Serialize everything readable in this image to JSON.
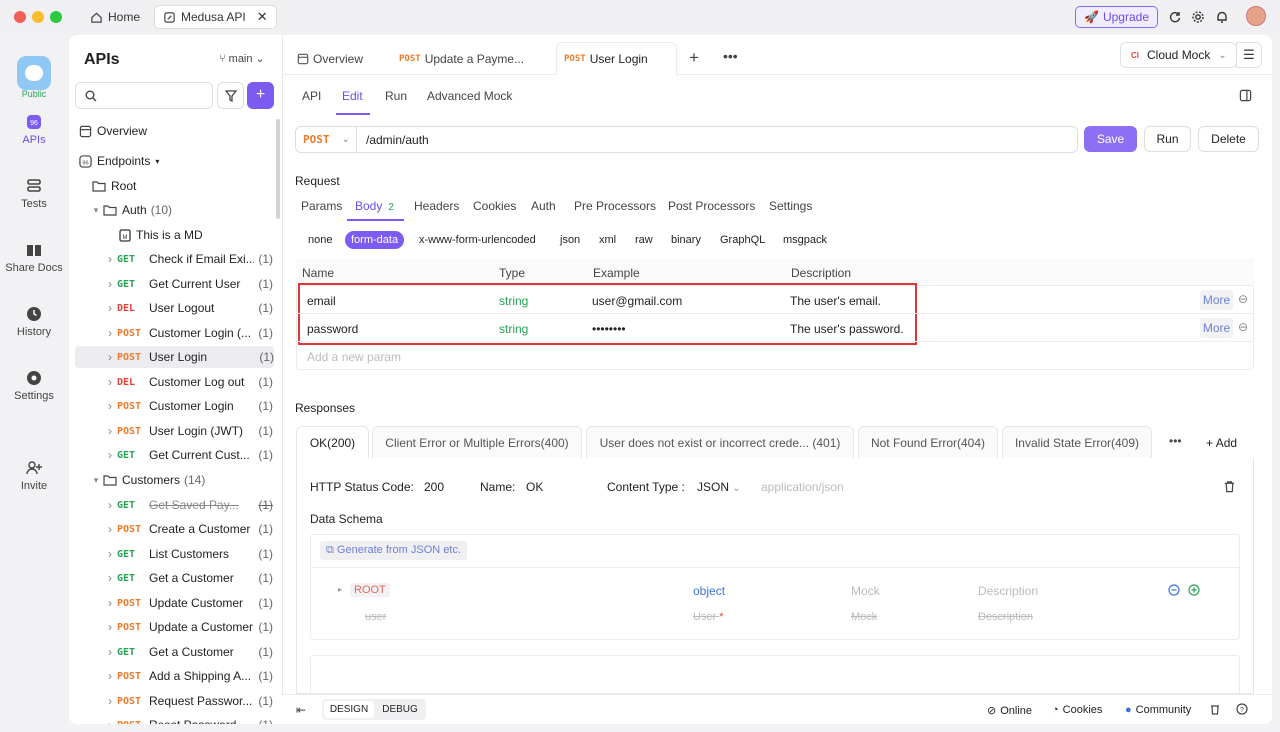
{
  "window": {
    "tabs": [
      {
        "label": "Home"
      },
      {
        "label": "Medusa API"
      }
    ],
    "upgrade": "Upgrade"
  },
  "rail": {
    "public": "Public",
    "items": [
      {
        "label": "APIs"
      },
      {
        "label": "Tests"
      },
      {
        "label": "Share Docs"
      },
      {
        "label": "History"
      },
      {
        "label": "Settings"
      },
      {
        "label": "Invite"
      }
    ]
  },
  "sidebar": {
    "title": "APIs",
    "branch": "main",
    "search_placeholder": "",
    "overview": "Overview",
    "endpoints": "Endpoints",
    "root": "Root",
    "folders": [
      {
        "name": "Auth",
        "count": "(10)"
      },
      {
        "name": "Customers",
        "count": "(14)"
      }
    ],
    "items": [
      {
        "method": "",
        "name": "This is a MD",
        "count": ""
      },
      {
        "method": "GET",
        "name": "Check if Email Exi...",
        "count": "(1)"
      },
      {
        "method": "GET",
        "name": "Get Current User",
        "count": "(1)"
      },
      {
        "method": "DEL",
        "name": "User Logout",
        "count": "(1)"
      },
      {
        "method": "POST",
        "name": "Customer Login (...",
        "count": "(1)"
      },
      {
        "method": "POST",
        "name": "User Login",
        "count": "(1)"
      },
      {
        "method": "DEL",
        "name": "Customer Log out",
        "count": "(1)"
      },
      {
        "method": "POST",
        "name": "Customer Login",
        "count": "(1)"
      },
      {
        "method": "POST",
        "name": "User Login (JWT)",
        "count": "(1)"
      },
      {
        "method": "GET",
        "name": "Get Current Cust...",
        "count": "(1)"
      },
      {
        "method": "GET",
        "name": "Get Saved Pay...",
        "count": "(1)"
      },
      {
        "method": "POST",
        "name": "Create a Customer",
        "count": "(1)"
      },
      {
        "method": "GET",
        "name": "List Customers",
        "count": "(1)"
      },
      {
        "method": "GET",
        "name": "Get a Customer",
        "count": "(1)"
      },
      {
        "method": "POST",
        "name": "Update Customer",
        "count": "(1)"
      },
      {
        "method": "POST",
        "name": "Update a Customer",
        "count": "(1)"
      },
      {
        "method": "GET",
        "name": "Get a Customer",
        "count": "(1)"
      },
      {
        "method": "POST",
        "name": "Add a Shipping A...",
        "count": "(1)"
      },
      {
        "method": "POST",
        "name": "Request Passwor...",
        "count": "(1)"
      },
      {
        "method": "POST",
        "name": "Reset Password",
        "count": "(1)"
      }
    ]
  },
  "doc_tabs": [
    {
      "method": "",
      "label": "Overview"
    },
    {
      "method": "POST",
      "label": "Update a Payme..."
    },
    {
      "method": "POST",
      "label": "User Login"
    }
  ],
  "cloud_mock": "Cloud Mock",
  "sub_tabs": [
    "API",
    "Edit",
    "Run",
    "Advanced Mock"
  ],
  "request": {
    "method": "POST",
    "url": "/admin/auth",
    "save": "Save",
    "run": "Run",
    "delete": "Delete",
    "section": "Request",
    "tabs": [
      "Params",
      "Body",
      "Headers",
      "Cookies",
      "Auth",
      "Pre Processors",
      "Post Processors",
      "Settings"
    ],
    "body_count": "2",
    "body_types": [
      "none",
      "form-data",
      "x-www-form-urlencoded",
      "json",
      "xml",
      "raw",
      "binary",
      "GraphQL",
      "msgpack"
    ],
    "columns": [
      "Name",
      "Type",
      "Example",
      "Description"
    ],
    "params": [
      {
        "name": "email",
        "type": "string",
        "example": "user@gmail.com",
        "description": "The user's email.",
        "more": "More"
      },
      {
        "name": "password",
        "type": "string",
        "example": "••••••••",
        "description": "The user's password.",
        "more": "More"
      }
    ],
    "add_param": "Add a new param"
  },
  "responses": {
    "section": "Responses",
    "tabs": [
      "OK(200)",
      "Client Error or Multiple Errors(400)",
      "User does not exist or incorrect crede... (401)",
      "Not Found Error(404)",
      "Invalid State Error(409)"
    ],
    "add": "Add",
    "status_label": "HTTP Status Code:",
    "status": "200",
    "name_label": "Name:",
    "name": "OK",
    "ctype_label": "Content Type :",
    "ctype": "JSON",
    "ctype_value": "application/json",
    "schema_title": "Data Schema",
    "generate": "Generate from JSON etc.",
    "schema": [
      {
        "name": "ROOT",
        "type": "object",
        "mock": "Mock",
        "desc": "Description"
      },
      {
        "name": "user",
        "type": "User",
        "mock": "Mock",
        "desc": "Description"
      }
    ]
  },
  "footer": {
    "design": "DESIGN",
    "debug": "DEBUG",
    "online": "Online",
    "cookies": "Cookies",
    "community": "Community"
  }
}
